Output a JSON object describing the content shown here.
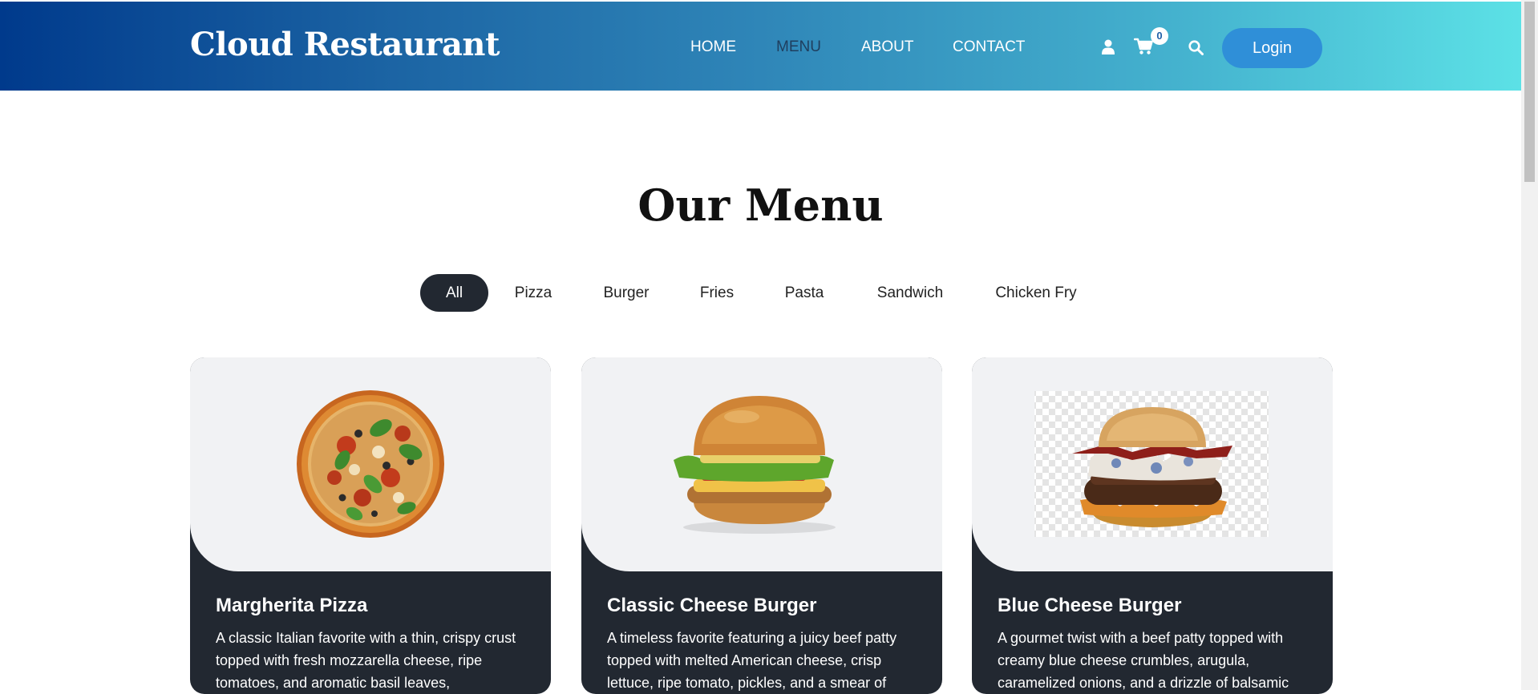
{
  "header": {
    "brand": "Cloud Restaurant",
    "nav": [
      {
        "label": "HOME",
        "active": false
      },
      {
        "label": "MENU",
        "active": true
      },
      {
        "label": "ABOUT",
        "active": false
      },
      {
        "label": "CONTACT",
        "active": false
      }
    ],
    "icons": [
      "user-icon",
      "cart-icon",
      "search-icon"
    ],
    "cart_count": "0",
    "login_label": "Login"
  },
  "menu": {
    "title": "Our Menu",
    "filters": [
      {
        "label": "All",
        "active": true
      },
      {
        "label": "Pizza",
        "active": false
      },
      {
        "label": "Burger",
        "active": false
      },
      {
        "label": "Fries",
        "active": false
      },
      {
        "label": "Pasta",
        "active": false
      },
      {
        "label": "Sandwich",
        "active": false
      },
      {
        "label": "Chicken Fry",
        "active": false
      }
    ],
    "items": [
      {
        "name": "Margherita Pizza",
        "description": "A classic Italian favorite with a thin, crispy crust topped with fresh mozzarella cheese, ripe tomatoes, and aromatic basil leaves,",
        "image": "pizza-image"
      },
      {
        "name": "Classic Cheese Burger",
        "description": "A timeless favorite featuring a juicy beef patty topped with melted American cheese, crisp lettuce, ripe tomato, pickles, and a smear of",
        "image": "cheese-burger-image"
      },
      {
        "name": "Blue Cheese Burger",
        "description": "A gourmet twist with a beef patty topped with creamy blue cheese crumbles, arugula, caramelized onions, and a drizzle of balsamic",
        "image": "blue-cheese-burger-image"
      }
    ]
  },
  "colors": {
    "header_gradient_start": "#003a8c",
    "header_gradient_end": "#5ce1e6",
    "nav_active": "#1f3e5e",
    "login_button": "#2f8fd8",
    "card_dark": "#222831",
    "card_light": "#f1f2f4",
    "filter_active_bg": "#222831"
  }
}
